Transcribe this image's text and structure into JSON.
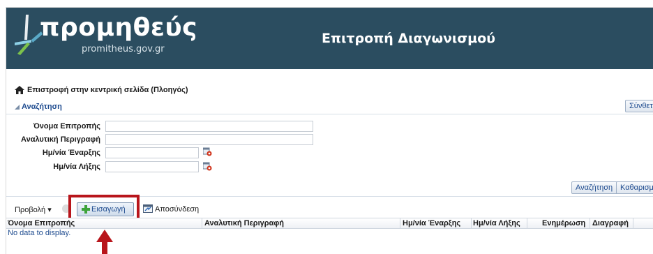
{
  "header": {
    "logo_text": "προμηθεύς",
    "logo_url": "promitheus.gov.gr",
    "title": "Επιτροπή Διαγωνισμού"
  },
  "nav": {
    "home_link": "Επιστροφή στην κεντρική σελίδα (Πλοηγός)",
    "search_toggle": "Αναζήτηση",
    "advanced_button": "Σύνθετη"
  },
  "search_form": {
    "fields": [
      {
        "label": "Όνομα Επιτροπής",
        "value": ""
      },
      {
        "label": "Αναλυτική Περιγραφή",
        "value": ""
      },
      {
        "label": "Ημ/νία Έναρξης",
        "value": ""
      },
      {
        "label": "Ημ/νία Λήξης",
        "value": ""
      }
    ],
    "search_button": "Αναζήτηση",
    "clear_button": "Καθαρισμ"
  },
  "toolbar": {
    "view_menu": "Προβολή",
    "insert_button": "Εισαγωγή",
    "disconnect_link": "Αποσύνδεση"
  },
  "table": {
    "columns": [
      "Όνομα Επιτροπής",
      "Αναλυτική Περιγραφή",
      "Ημ/νία Έναρξης",
      "Ημ/νία Λήξης",
      "Ενημέρωση",
      "Διαγραφή"
    ],
    "empty_text": "No data to display."
  },
  "colors": {
    "header_bg": "#2b4d60",
    "highlight": "#b8151b",
    "link": "#1e4b8f"
  }
}
